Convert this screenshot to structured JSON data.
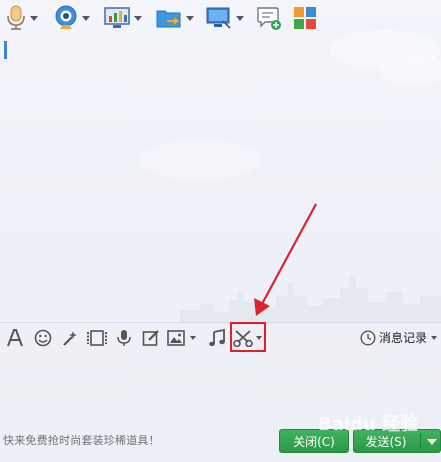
{
  "toolbar_top": {
    "items": [
      {
        "icon": "microphone-icon"
      },
      {
        "icon": "webcam-icon"
      },
      {
        "icon": "screen-share-icon"
      },
      {
        "icon": "send-file-icon"
      },
      {
        "icon": "remote-desktop-icon"
      },
      {
        "icon": "new-chat-icon"
      },
      {
        "icon": "apps-icon"
      }
    ]
  },
  "toolbar_bottom": {
    "items": [
      {
        "icon": "font-icon"
      },
      {
        "icon": "emoji-icon"
      },
      {
        "icon": "magic-wand-icon"
      },
      {
        "icon": "video-clip-icon"
      },
      {
        "icon": "voice-message-icon"
      },
      {
        "icon": "edit-icon"
      },
      {
        "icon": "image-icon"
      },
      {
        "icon": "music-icon"
      },
      {
        "icon": "scissors-icon"
      }
    ],
    "history_label": "消息记录",
    "history_icon": "clock-icon"
  },
  "footer": {
    "promo_text": "快来免费抢时尚套装珍稀道具！",
    "close_label": "关闭(C)",
    "send_label": "发送(S)"
  },
  "watermark": "Baidu 经验",
  "colors": {
    "accent_green": "#2fa24f",
    "highlight_red": "#e0202a",
    "arrow_red": "#d8262e",
    "icon_blue": "#2a7fd0"
  }
}
